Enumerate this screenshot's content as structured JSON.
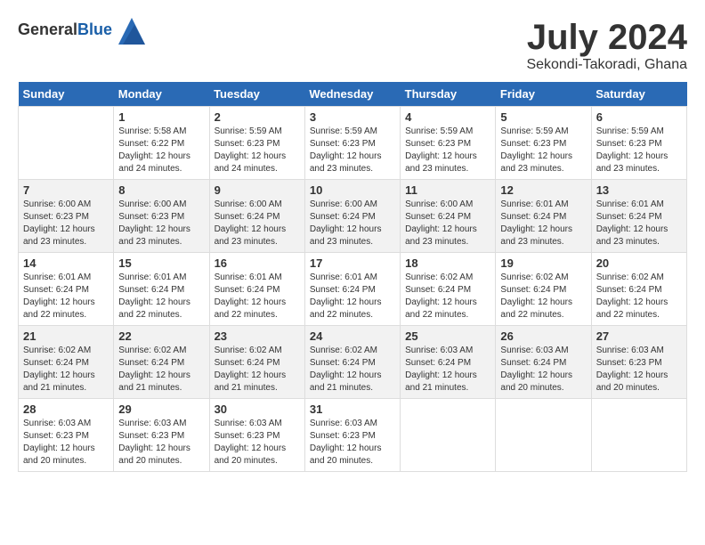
{
  "header": {
    "logo_general": "General",
    "logo_blue": "Blue",
    "month_year": "July 2024",
    "location": "Sekondi-Takoradi, Ghana"
  },
  "weekdays": [
    "Sunday",
    "Monday",
    "Tuesday",
    "Wednesday",
    "Thursday",
    "Friday",
    "Saturday"
  ],
  "weeks": [
    [
      {
        "day": "",
        "sunrise": "",
        "sunset": "",
        "daylight": ""
      },
      {
        "day": "1",
        "sunrise": "5:58 AM",
        "sunset": "6:22 PM",
        "daylight": "12 hours and 24 minutes."
      },
      {
        "day": "2",
        "sunrise": "5:59 AM",
        "sunset": "6:23 PM",
        "daylight": "12 hours and 24 minutes."
      },
      {
        "day": "3",
        "sunrise": "5:59 AM",
        "sunset": "6:23 PM",
        "daylight": "12 hours and 23 minutes."
      },
      {
        "day": "4",
        "sunrise": "5:59 AM",
        "sunset": "6:23 PM",
        "daylight": "12 hours and 23 minutes."
      },
      {
        "day": "5",
        "sunrise": "5:59 AM",
        "sunset": "6:23 PM",
        "daylight": "12 hours and 23 minutes."
      },
      {
        "day": "6",
        "sunrise": "5:59 AM",
        "sunset": "6:23 PM",
        "daylight": "12 hours and 23 minutes."
      }
    ],
    [
      {
        "day": "7",
        "sunrise": "6:00 AM",
        "sunset": "6:23 PM",
        "daylight": "12 hours and 23 minutes."
      },
      {
        "day": "8",
        "sunrise": "6:00 AM",
        "sunset": "6:23 PM",
        "daylight": "12 hours and 23 minutes."
      },
      {
        "day": "9",
        "sunrise": "6:00 AM",
        "sunset": "6:24 PM",
        "daylight": "12 hours and 23 minutes."
      },
      {
        "day": "10",
        "sunrise": "6:00 AM",
        "sunset": "6:24 PM",
        "daylight": "12 hours and 23 minutes."
      },
      {
        "day": "11",
        "sunrise": "6:00 AM",
        "sunset": "6:24 PM",
        "daylight": "12 hours and 23 minutes."
      },
      {
        "day": "12",
        "sunrise": "6:01 AM",
        "sunset": "6:24 PM",
        "daylight": "12 hours and 23 minutes."
      },
      {
        "day": "13",
        "sunrise": "6:01 AM",
        "sunset": "6:24 PM",
        "daylight": "12 hours and 23 minutes."
      }
    ],
    [
      {
        "day": "14",
        "sunrise": "6:01 AM",
        "sunset": "6:24 PM",
        "daylight": "12 hours and 22 minutes."
      },
      {
        "day": "15",
        "sunrise": "6:01 AM",
        "sunset": "6:24 PM",
        "daylight": "12 hours and 22 minutes."
      },
      {
        "day": "16",
        "sunrise": "6:01 AM",
        "sunset": "6:24 PM",
        "daylight": "12 hours and 22 minutes."
      },
      {
        "day": "17",
        "sunrise": "6:01 AM",
        "sunset": "6:24 PM",
        "daylight": "12 hours and 22 minutes."
      },
      {
        "day": "18",
        "sunrise": "6:02 AM",
        "sunset": "6:24 PM",
        "daylight": "12 hours and 22 minutes."
      },
      {
        "day": "19",
        "sunrise": "6:02 AM",
        "sunset": "6:24 PM",
        "daylight": "12 hours and 22 minutes."
      },
      {
        "day": "20",
        "sunrise": "6:02 AM",
        "sunset": "6:24 PM",
        "daylight": "12 hours and 22 minutes."
      }
    ],
    [
      {
        "day": "21",
        "sunrise": "6:02 AM",
        "sunset": "6:24 PM",
        "daylight": "12 hours and 21 minutes."
      },
      {
        "day": "22",
        "sunrise": "6:02 AM",
        "sunset": "6:24 PM",
        "daylight": "12 hours and 21 minutes."
      },
      {
        "day": "23",
        "sunrise": "6:02 AM",
        "sunset": "6:24 PM",
        "daylight": "12 hours and 21 minutes."
      },
      {
        "day": "24",
        "sunrise": "6:02 AM",
        "sunset": "6:24 PM",
        "daylight": "12 hours and 21 minutes."
      },
      {
        "day": "25",
        "sunrise": "6:03 AM",
        "sunset": "6:24 PM",
        "daylight": "12 hours and 21 minutes."
      },
      {
        "day": "26",
        "sunrise": "6:03 AM",
        "sunset": "6:24 PM",
        "daylight": "12 hours and 20 minutes."
      },
      {
        "day": "27",
        "sunrise": "6:03 AM",
        "sunset": "6:23 PM",
        "daylight": "12 hours and 20 minutes."
      }
    ],
    [
      {
        "day": "28",
        "sunrise": "6:03 AM",
        "sunset": "6:23 PM",
        "daylight": "12 hours and 20 minutes."
      },
      {
        "day": "29",
        "sunrise": "6:03 AM",
        "sunset": "6:23 PM",
        "daylight": "12 hours and 20 minutes."
      },
      {
        "day": "30",
        "sunrise": "6:03 AM",
        "sunset": "6:23 PM",
        "daylight": "12 hours and 20 minutes."
      },
      {
        "day": "31",
        "sunrise": "6:03 AM",
        "sunset": "6:23 PM",
        "daylight": "12 hours and 20 minutes."
      },
      {
        "day": "",
        "sunrise": "",
        "sunset": "",
        "daylight": ""
      },
      {
        "day": "",
        "sunrise": "",
        "sunset": "",
        "daylight": ""
      },
      {
        "day": "",
        "sunrise": "",
        "sunset": "",
        "daylight": ""
      }
    ]
  ]
}
